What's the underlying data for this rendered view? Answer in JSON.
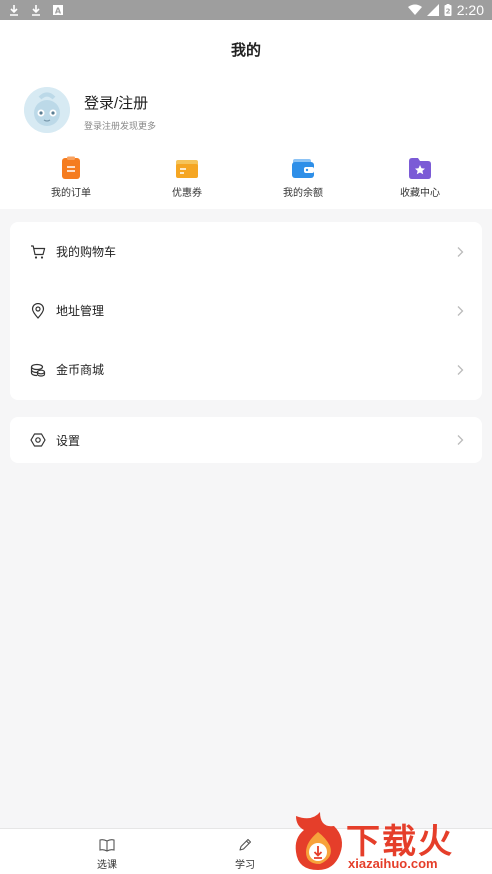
{
  "status_bar": {
    "time": "2:20",
    "battery_level": "2"
  },
  "header": {
    "title": "我的"
  },
  "profile": {
    "login_title": "登录/注册",
    "login_subtitle": "登录注册发现更多"
  },
  "quick_actions": [
    {
      "label": "我的订单",
      "icon": "order-icon",
      "color": "#f57c1f"
    },
    {
      "label": "优惠券",
      "icon": "coupon-icon",
      "color": "#f5a623"
    },
    {
      "label": "我的余额",
      "icon": "wallet-icon",
      "color": "#2e8fe8"
    },
    {
      "label": "收藏中心",
      "icon": "favorite-icon",
      "color": "#7b5bd6"
    }
  ],
  "menu": [
    {
      "label": "我的购物车",
      "icon": "cart-icon"
    },
    {
      "label": "地址管理",
      "icon": "location-icon"
    },
    {
      "label": "金币商城",
      "icon": "coins-icon"
    }
  ],
  "settings": {
    "label": "设置",
    "icon": "settings-icon"
  },
  "tabbar": [
    {
      "label": "选课",
      "icon": "book-icon"
    },
    {
      "label": "学习",
      "icon": "pen-icon"
    }
  ],
  "watermark": {
    "text": "下载火",
    "url": "xiazaihuo.com"
  }
}
